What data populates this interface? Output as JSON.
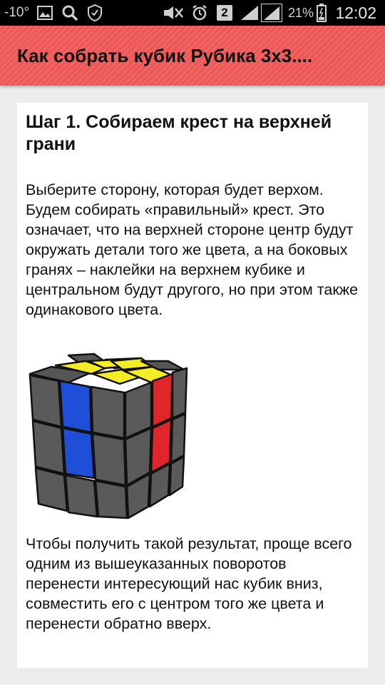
{
  "status_bar": {
    "temperature": "-10°",
    "battery_percent": "21%",
    "sim_badge": "2",
    "clock": "12:02",
    "icons": [
      "image-icon",
      "search-icon",
      "shield-icon",
      "mute-icon",
      "alarm-icon",
      "sim-icon",
      "signal-icon",
      "signal-icon",
      "battery-icon"
    ]
  },
  "app_bar": {
    "title": "Как собрать кубик Рубика 3x3....",
    "color": "#f15a5a"
  },
  "content": {
    "step_title": "Шаг 1. Собираем крест на верхней грани",
    "paragraph_1": "Выберите сторону, которая будет верхом. Будем собирать «правильный» крест. Это означает, что на верхней стороне центр будут окружать детали того же цвета, а на боковых гранях – наклейки на верхнем кубике и центральном будут другого, но при этом также одинакового цвета.",
    "image": {
      "name": "rubiks-cube-cross-illustration",
      "colors": {
        "top_cross": "#f4ec24",
        "left_face": "#1f4fd8",
        "right_face": "#e0262a",
        "gray": "#5a5a5a"
      }
    },
    "paragraph_2": "Чтобы получить такой результат, проще всего одним из вышеуказанных поворотов перенести интересующий нас кубик вниз, совместить его с центром того же цвета и перенести обратно вверх."
  }
}
